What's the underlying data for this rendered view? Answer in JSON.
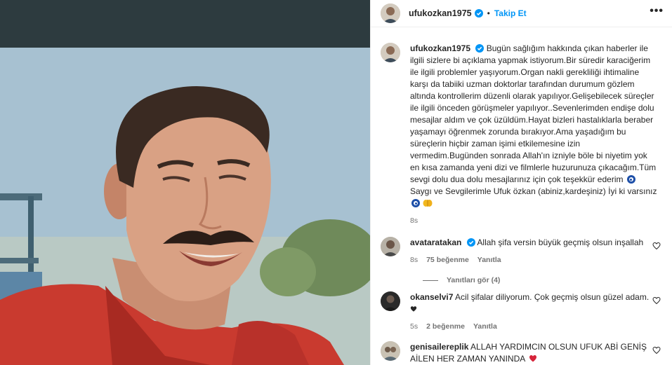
{
  "post": {
    "username": "ufukozkan1975",
    "separator": "•",
    "follow_label": "Takip Et",
    "more_label": "•••",
    "caption": {
      "username": "ufukozkan1975",
      "text": "Bugün sağlığım hakkında çıkan haberler ile ilgili sizlere bi açıklama yapmak istiyorum.Bir süredir karaciğerim ile ilgili problemler yaşıyorum.Organ nakli gerekliliği ihtimaline karşı da tabiiki uzman doktorlar tarafından durumum gözlem altında kontrollerim düzenli olarak yapılıyor.Gelişebilecek süreçler ile ilgili önceden görüşmeler yapılıyor..Sevenlerimden endişe dolu mesajlar aldım ve çok üzüldüm.Hayat bizleri hastalıklarla beraber yaşamayı öğrenmek zorunda bırakıyor.Ama yaşadığım bu süreçlerin hiçbir zaman işimi etkilemesine izin vermedim.Bugünden sonrada Allah'ın izniyle böle bi niyetim yok en kısa zamanda yeni dizi ve filmlerle huzurunuza çıkacağım.Tüm sevgi dolu dua dolu mesajlarınız için çok teşekkür ederim",
      "text_line2": "Saygı ve Sevgilerimle Ufuk özkan (abiniz,kardeşiniz) İyi ki varsınız",
      "time": "8s"
    }
  },
  "comments": [
    {
      "username": "avataratakan",
      "text": "Allah şifa versin büyük geçmiş olsun inşallah",
      "time": "8s",
      "likes": "75 beğenme",
      "reply_label": "Yanıtla",
      "view_replies": "Yanıtları gör (4)"
    },
    {
      "username": "okanselvi7",
      "text": "Acil şifalar diliyorum. Çok geçmiş olsun güzel adam.",
      "time": "5s",
      "likes": "2 beğenme",
      "reply_label": "Yanıtla"
    },
    {
      "username": "genisailereplik",
      "text": "ALLAH YARDIMCIN OLSUN UFUK ABİ GENİŞ AİLEN HER ZAMAN YANINDA"
    }
  ],
  "colors": {
    "link_blue": "#0095f6",
    "verified_blue": "#0095f6",
    "muted": "#737373",
    "heart_red": "#d6243a"
  },
  "icons": {
    "verified": "verified-badge-icon",
    "heart": "heart-outline-icon",
    "more": "more-options-icon"
  }
}
